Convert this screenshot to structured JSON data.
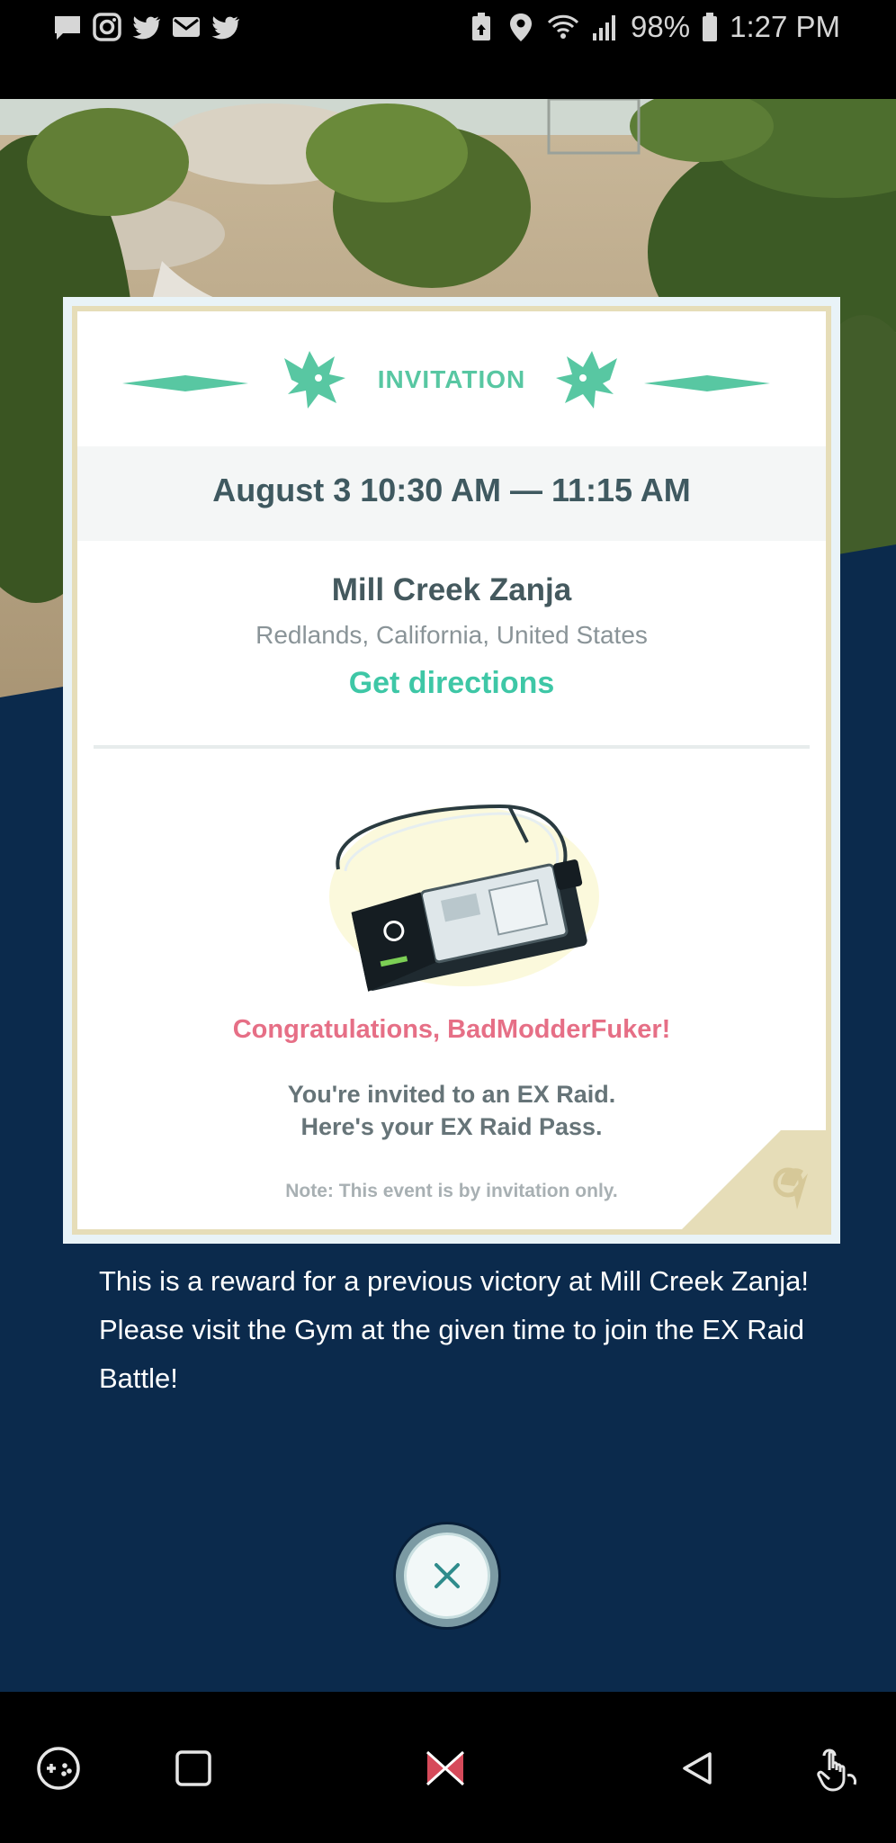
{
  "status_bar": {
    "left_icons": [
      "chat-icon",
      "instagram-icon",
      "twitter-icon",
      "mail-icon",
      "twitter-icon"
    ],
    "battery": "98%",
    "time": "1:27 PM"
  },
  "card": {
    "header": "INVITATION",
    "date_time": "August 3  10:30 AM  —  11:15 AM",
    "gym_name": "Mill Creek Zanja",
    "location": "Redlands, California, United States",
    "directions_label": "Get directions",
    "congrats": "Congratulations, BadModderFuker!",
    "invite_line_1": "You're invited to an EX Raid.",
    "invite_line_2": "Here's your EX Raid Pass.",
    "note": "Note: This event is by invitation only."
  },
  "reward_message": {
    "line_1": "This is a reward for a previous victory at Mill Creek Zanja!",
    "line_2": "Please visit the Gym at the given time to join the EX Raid Battle!"
  },
  "colors": {
    "accent_teal": "#3ec7a6",
    "congrats_pink": "#e66f86",
    "navy_background": "#0b2a4c"
  },
  "nav_bar": {
    "icons": [
      "game-launcher-icon",
      "recent-apps-icon",
      "home-icon",
      "back-icon",
      "touch-gesture-icon"
    ]
  }
}
